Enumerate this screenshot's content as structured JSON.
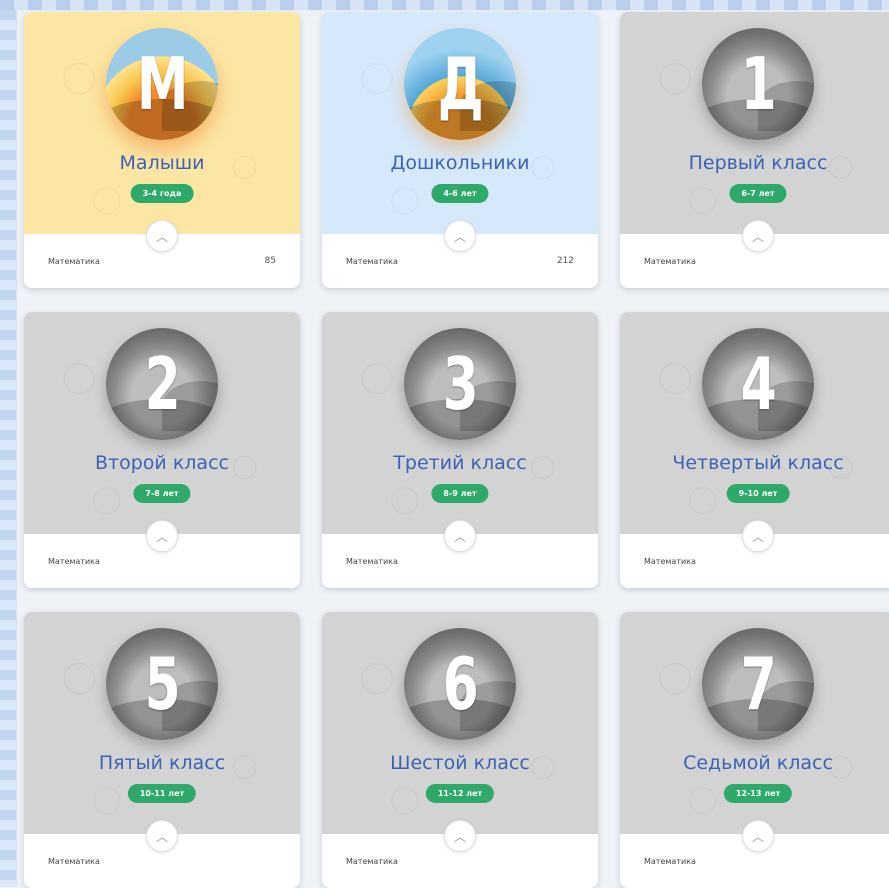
{
  "cards": [
    {
      "glyph": "М",
      "title": "Малыши",
      "age": "3-4 года",
      "subject": "Математика",
      "count": "85",
      "theme": "yellow",
      "medallion": "color-a"
    },
    {
      "glyph": "Д",
      "title": "Дошкольники",
      "age": "4-6 лет",
      "subject": "Математика",
      "count": "212",
      "theme": "blue",
      "medallion": "color-b"
    },
    {
      "glyph": "1",
      "title": "Первый класс",
      "age": "6-7 лет",
      "subject": "Математика",
      "count": "",
      "theme": "gray",
      "medallion": "gray"
    },
    {
      "glyph": "2",
      "title": "Второй класс",
      "age": "7-8 лет",
      "subject": "Математика",
      "count": "",
      "theme": "gray",
      "medallion": "gray"
    },
    {
      "glyph": "3",
      "title": "Третий класс",
      "age": "8-9 лет",
      "subject": "Математика",
      "count": "",
      "theme": "gray",
      "medallion": "gray"
    },
    {
      "glyph": "4",
      "title": "Четвертый класс",
      "age": "9-10 лет",
      "subject": "Математика",
      "count": "",
      "theme": "gray",
      "medallion": "gray"
    },
    {
      "glyph": "5",
      "title": "Пятый класс",
      "age": "10-11 лет",
      "subject": "Математика",
      "count": "",
      "theme": "gray",
      "medallion": "gray"
    },
    {
      "glyph": "6",
      "title": "Шестой класс",
      "age": "11-12 лет",
      "subject": "Математика",
      "count": "",
      "theme": "gray",
      "medallion": "gray"
    },
    {
      "glyph": "7",
      "title": "Седьмой класс",
      "age": "12-13 лет",
      "subject": "Математика",
      "count": "",
      "theme": "gray",
      "medallion": "gray"
    }
  ],
  "icons": {
    "expand": "chevron-up-icon"
  },
  "colors": {
    "title": "#3d63b7",
    "badge": "#2ea96a",
    "yellow_card": "#fbe6a3",
    "blue_card": "#d6e9fb",
    "gray_card": "#d3d3d3"
  }
}
